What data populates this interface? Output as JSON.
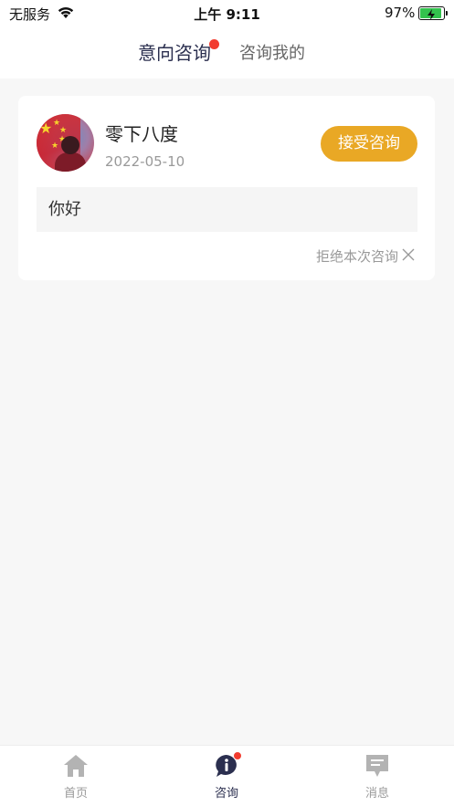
{
  "status_bar": {
    "carrier": "无服务",
    "time": "上午 9:11",
    "battery_percent": "97%",
    "battery_level": 0.97
  },
  "tabs": {
    "intent": "意向咨询",
    "mine": "咨询我的"
  },
  "card": {
    "username": "零下八度",
    "date": "2022-05-10",
    "accept_label": "接受咨询",
    "message": "你好",
    "reject_label": "拒绝本次咨询"
  },
  "bottom_nav": {
    "home": "首页",
    "consult": "咨询",
    "messages": "消息"
  },
  "colors": {
    "accent": "#e9a825",
    "active_tab": "#2b2f4f",
    "badge": "#f23c2f"
  }
}
